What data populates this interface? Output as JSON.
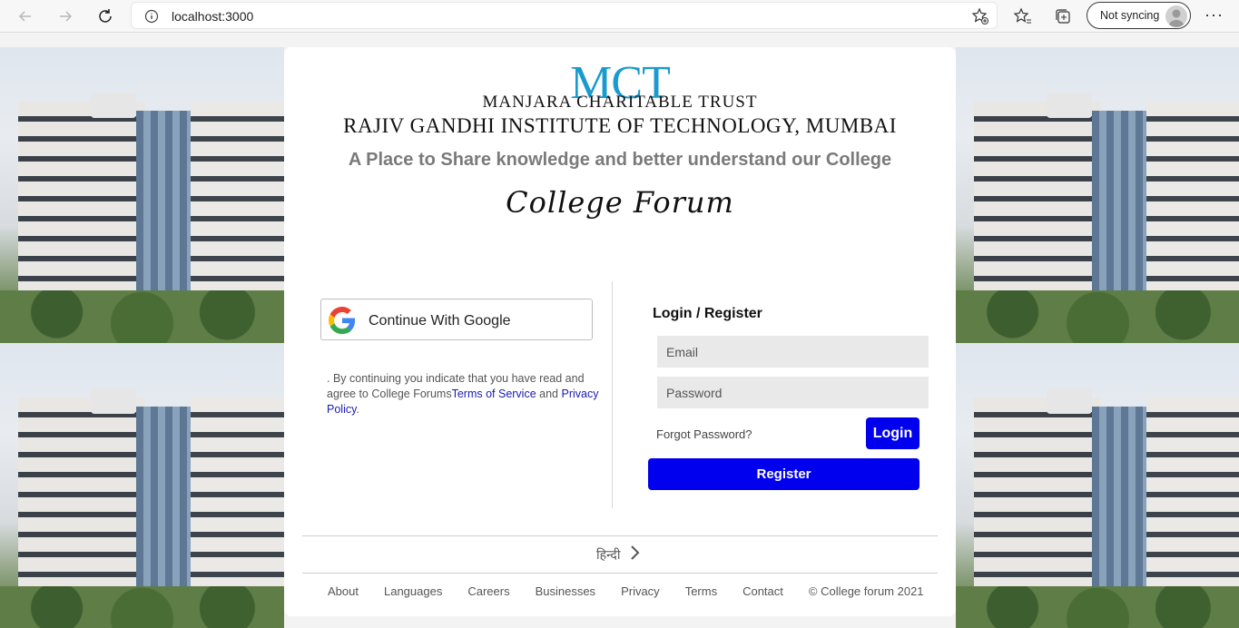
{
  "browser": {
    "url": "localhost:3000",
    "sync_label": "Not syncing",
    "more_label": "···"
  },
  "header": {
    "logo_text": "MCT",
    "trust_name": "MANJARA CHARITABLE TRUST",
    "institute_name": "RAJIV GANDHI INSTITUTE OF TECHNOLOGY, MUMBAI",
    "tagline": "A Place to Share knowledge and better understand our College",
    "forum_logo": "College Forum"
  },
  "google": {
    "label": "Continue With Google"
  },
  "terms": {
    "prefix": ". By continuing you indicate that you have read and agree to College Forums",
    "tos_link": "Terms of Service",
    "and": " and",
    "privacy_link": "Privacy Policy",
    "suffix": "."
  },
  "login": {
    "title": "Login / Register",
    "email_placeholder": "Email",
    "password_placeholder": "Password",
    "forgot": "Forgot Password?",
    "login_label": "Login",
    "register_label": "Register"
  },
  "language": {
    "label": "हिन्दी"
  },
  "footer": {
    "links": [
      "About",
      "Languages",
      "Careers",
      "Businesses",
      "Privacy",
      "Terms",
      "Contact"
    ],
    "copyright": "© College forum 2021"
  }
}
